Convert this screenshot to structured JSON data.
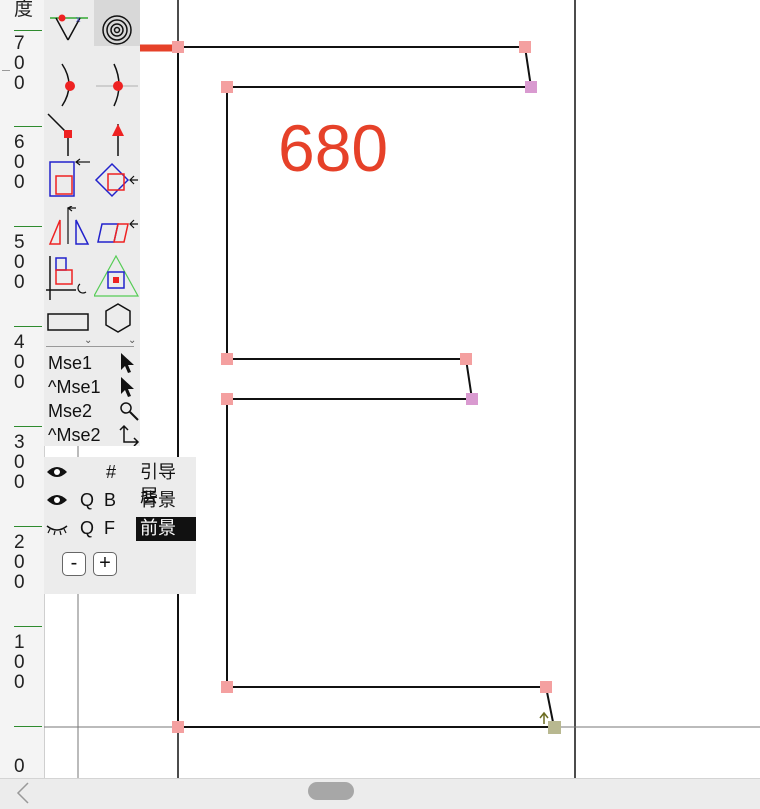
{
  "ruler": {
    "top_char": "度",
    "labels": [
      {
        "digits": [
          "7",
          "0",
          "0"
        ],
        "value": "700"
      },
      {
        "digits": [
          "6",
          "0",
          "0"
        ],
        "value": "600"
      },
      {
        "digits": [
          "5",
          "0",
          "0"
        ],
        "value": "500"
      },
      {
        "digits": [
          "4",
          "0",
          "0"
        ],
        "value": "400"
      },
      {
        "digits": [
          "3",
          "0",
          "0"
        ],
        "value": "300"
      },
      {
        "digits": [
          "2",
          "0",
          "0"
        ],
        "value": "200"
      },
      {
        "digits": [
          "1",
          "0",
          "0"
        ],
        "value": "100"
      },
      {
        "digits": [
          "0"
        ],
        "value": "0"
      }
    ]
  },
  "canvas": {
    "big_label": "680",
    "glyph": "E",
    "accent_color": "#e64129",
    "point_color": "#f4a0a0",
    "selected_point_color": "#d99ad0"
  },
  "palette": {
    "tools": [
      "pen-tool-icon",
      "spiral-tool-icon",
      "curve-point-icon",
      "smooth-point-icon",
      "corner-point-icon",
      "tangent-point-icon",
      "add-component-icon",
      "rotate-diamond-icon",
      "slant-tool-icon",
      "skew-tool-icon",
      "metrics-tool-icon",
      "triangle-tool-icon",
      "rectangle-tool-icon",
      "polygon-tool-icon"
    ],
    "mouse_rows": [
      {
        "label": "Mse1",
        "icon": "arrow-cursor-icon"
      },
      {
        "label": "^Mse1",
        "icon": "arrow-cursor-icon"
      },
      {
        "label": "Mse2",
        "icon": "magnify-icon"
      },
      {
        "label": "^Mse2",
        "icon": "scroll-arrow-icon"
      }
    ]
  },
  "layers": {
    "rows": [
      {
        "eye": "eye-open-icon",
        "q": "",
        "type": "#",
        "name": "引导层",
        "selected": false
      },
      {
        "eye": "eye-open-icon",
        "q": "Q",
        "type": "B",
        "name": "背景",
        "selected": false
      },
      {
        "eye": "eye-closed-icon",
        "q": "Q",
        "type": "F",
        "name": "前景",
        "selected": true
      }
    ],
    "minus_label": "-",
    "plus_label": "+"
  }
}
